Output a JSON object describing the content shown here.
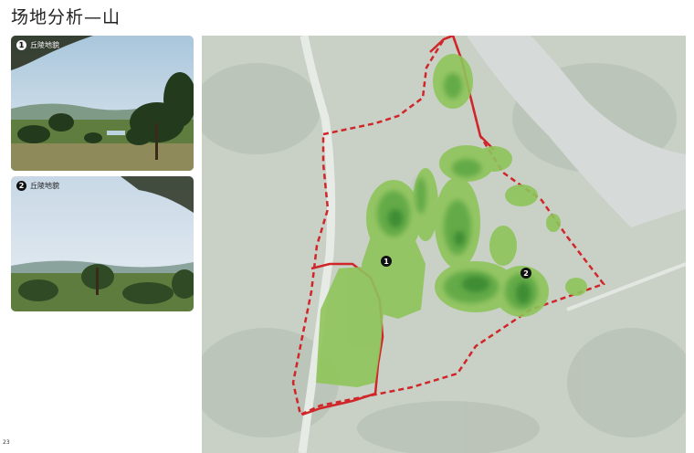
{
  "page": {
    "title": "场地分析—山",
    "page_number": "23"
  },
  "photos": [
    {
      "number": "1",
      "caption": "丘陵地貌"
    },
    {
      "number": "2",
      "caption": "丘陵地貌"
    }
  ],
  "map": {
    "markers": [
      {
        "number": "1"
      },
      {
        "number": "2"
      }
    ],
    "colors": {
      "boundary": "#d0262a",
      "hill_light": "#8fc45a",
      "hill_mid": "#5fa844",
      "hill_dark": "#3a8a33"
    }
  }
}
